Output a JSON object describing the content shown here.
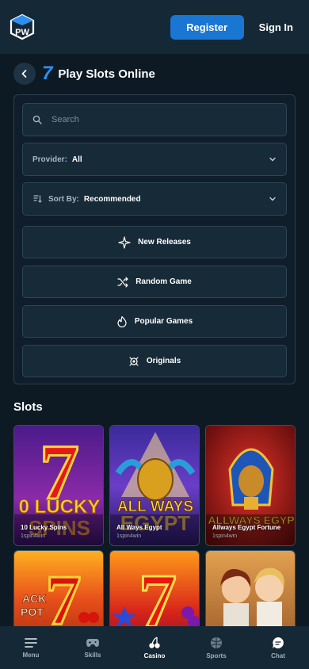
{
  "header": {
    "logo_text": "PW",
    "register_label": "Register",
    "signin_label": "Sign In"
  },
  "title_row": {
    "category_glyph": "7",
    "title": "Play Slots Online"
  },
  "filters": {
    "search_placeholder": "Search",
    "provider_label": "Provider:",
    "provider_value": "All",
    "sort_label": "Sort By:",
    "sort_value": "Recommended",
    "actions": [
      {
        "label": "New Releases",
        "icon": "sparkle-icon"
      },
      {
        "label": "Random Game",
        "icon": "shuffle-icon"
      },
      {
        "label": "Popular Games",
        "icon": "fire-icon"
      },
      {
        "label": "Originals",
        "icon": "originals-icon"
      }
    ]
  },
  "slots": {
    "heading": "Slots",
    "games": [
      {
        "name": "10 Lucky Spins",
        "provider": "1spin4win"
      },
      {
        "name": "All Ways Egypt",
        "provider": "1spin4win"
      },
      {
        "name": "Allways Egypt Fortune",
        "provider": "1spin4win"
      },
      {
        "name": "",
        "provider": ""
      },
      {
        "name": "",
        "provider": ""
      },
      {
        "name": "",
        "provider": ""
      }
    ]
  },
  "bottom_nav": [
    {
      "label": "Menu",
      "icon": "menu-icon"
    },
    {
      "label": "Skills",
      "icon": "gamepad-icon"
    },
    {
      "label": "Casino",
      "icon": "cherries-icon"
    },
    {
      "label": "Sports",
      "icon": "ball-icon"
    },
    {
      "label": "Chat",
      "icon": "chat-icon"
    }
  ],
  "colors": {
    "background": "#0d1a24",
    "header": "#152835",
    "accent": "#1976d2"
  }
}
